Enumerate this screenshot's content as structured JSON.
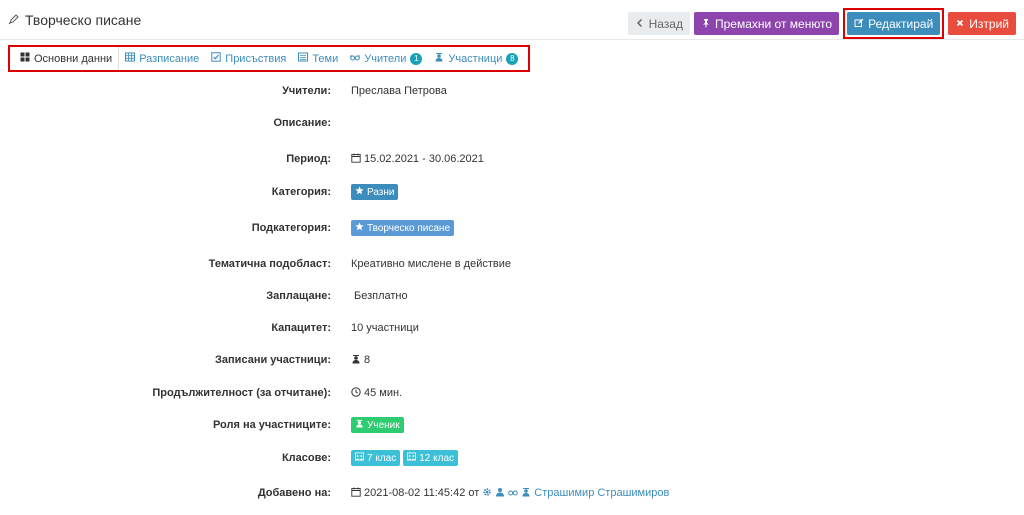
{
  "header": {
    "title": "Творческо писане",
    "buttons": {
      "back": "Назад",
      "unpin": "Премахни от менюто",
      "edit": "Редактирай",
      "delete": "Изтрий"
    }
  },
  "tabs": [
    {
      "label": "Основни данни",
      "icon": "grid-icon"
    },
    {
      "label": "Разписание",
      "icon": "table-icon"
    },
    {
      "label": "Присъствия",
      "icon": "checkbox-icon"
    },
    {
      "label": "Теми",
      "icon": "list-icon"
    },
    {
      "label": "Учители",
      "icon": "glasses-icon",
      "count": "1"
    },
    {
      "label": "Участници",
      "icon": "student-icon",
      "count": "8"
    }
  ],
  "details": {
    "teachers_label": "Учители:",
    "teachers_value": "Преслава Петрова",
    "description_label": "Описание:",
    "description_value": "",
    "period_label": "Период:",
    "period_value": "15.02.2021 - 30.06.2021",
    "category_label": "Категория:",
    "category_value": "Разни",
    "subcategory_label": "Подкатегория:",
    "subcategory_value": "Творческо писане",
    "subfield_label": "Тематична подобласт:",
    "subfield_value": "Креативно мислене в действие",
    "payment_label": "Заплащане:",
    "payment_value": "Безплатно",
    "capacity_label": "Капацитет:",
    "capacity_value": "10 участници",
    "enrolled_label": "Записани участници:",
    "enrolled_value": "8",
    "duration_label": "Продължителност (за отчитане):",
    "duration_value": "45 мин.",
    "role_label": "Роля на участниците:",
    "role_value": "Ученик",
    "classes_label": "Класове:",
    "classes": [
      "7 клас",
      "12 клас"
    ],
    "added_label": "Добавено на:",
    "added_date": "2021-08-02 11:45:42 от",
    "added_by": "Страшимир Страшимиров"
  },
  "colors": {
    "accent": "#3c8dbc",
    "unpin": "#8e44ad",
    "delete": "#e74c3c",
    "highlight": "#dd0000"
  }
}
